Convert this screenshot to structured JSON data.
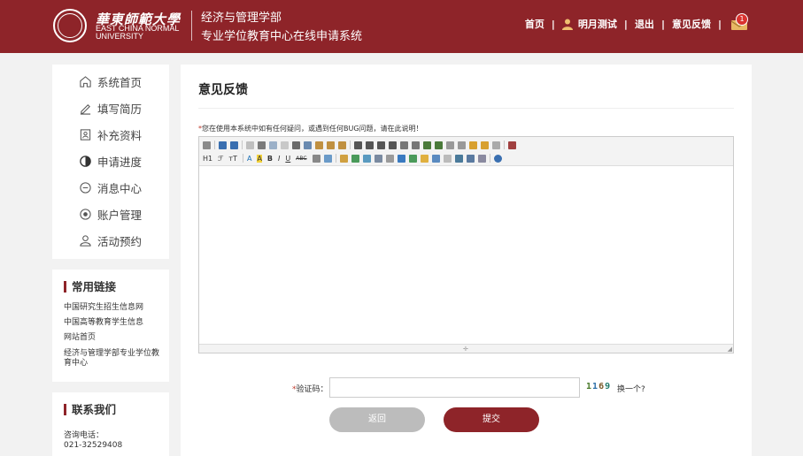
{
  "header": {
    "logo_cn": "華東師範大學",
    "logo_en_line1": "EAST CHINA NORMAL",
    "logo_en_line2": "UNIVERSITY",
    "department": "经济与管理学部",
    "system_name": "专业学位教育中心在线申请系统",
    "nav": {
      "home": "首页",
      "user": "明月测试",
      "logout": "退出",
      "feedback": "意见反馈",
      "separator": "|",
      "message_badge": "1"
    }
  },
  "sidebar": {
    "menu": [
      {
        "label": "系统首页",
        "icon": "home-icon"
      },
      {
        "label": "填写简历",
        "icon": "edit-icon"
      },
      {
        "label": "补充资料",
        "icon": "document-icon"
      },
      {
        "label": "申请进度",
        "icon": "progress-icon"
      },
      {
        "label": "消息中心",
        "icon": "message-icon"
      },
      {
        "label": "账户管理",
        "icon": "account-icon"
      },
      {
        "label": "活动预约",
        "icon": "appointment-icon"
      }
    ],
    "links": {
      "title": "常用链接",
      "items": [
        "中国研究生招生信息网",
        "中国高等教育学生信息",
        "网站首页",
        "经济与管理学部专业学位教育中心"
      ]
    },
    "contact": {
      "title": "联系我们",
      "phone_label": "咨询电话：",
      "phone": "021-32529408"
    }
  },
  "main": {
    "title": "意见反馈",
    "hint_star": "*",
    "hint": "您在使用本系统中如有任何疑问，或遇到任何BUG问题，请在此说明！",
    "editor_value": "",
    "toolbar": {
      "heading": "H1",
      "font": "ℱ",
      "size": "тT",
      "font_color": "A",
      "bg_color": "A",
      "bold": "B",
      "italic": "I",
      "underline": "U",
      "strike": "ABC"
    },
    "captcha": {
      "star": "*",
      "label": "验证码：",
      "value": "",
      "code_chars": [
        "1",
        "1",
        "6",
        "9"
      ],
      "refresh": "换一个?"
    },
    "buttons": {
      "back": "返回",
      "submit": "提交"
    }
  },
  "colors": {
    "brand": "#8e2429",
    "back_button": "#bcbcbc",
    "page_bg": "#f2f2f2"
  }
}
